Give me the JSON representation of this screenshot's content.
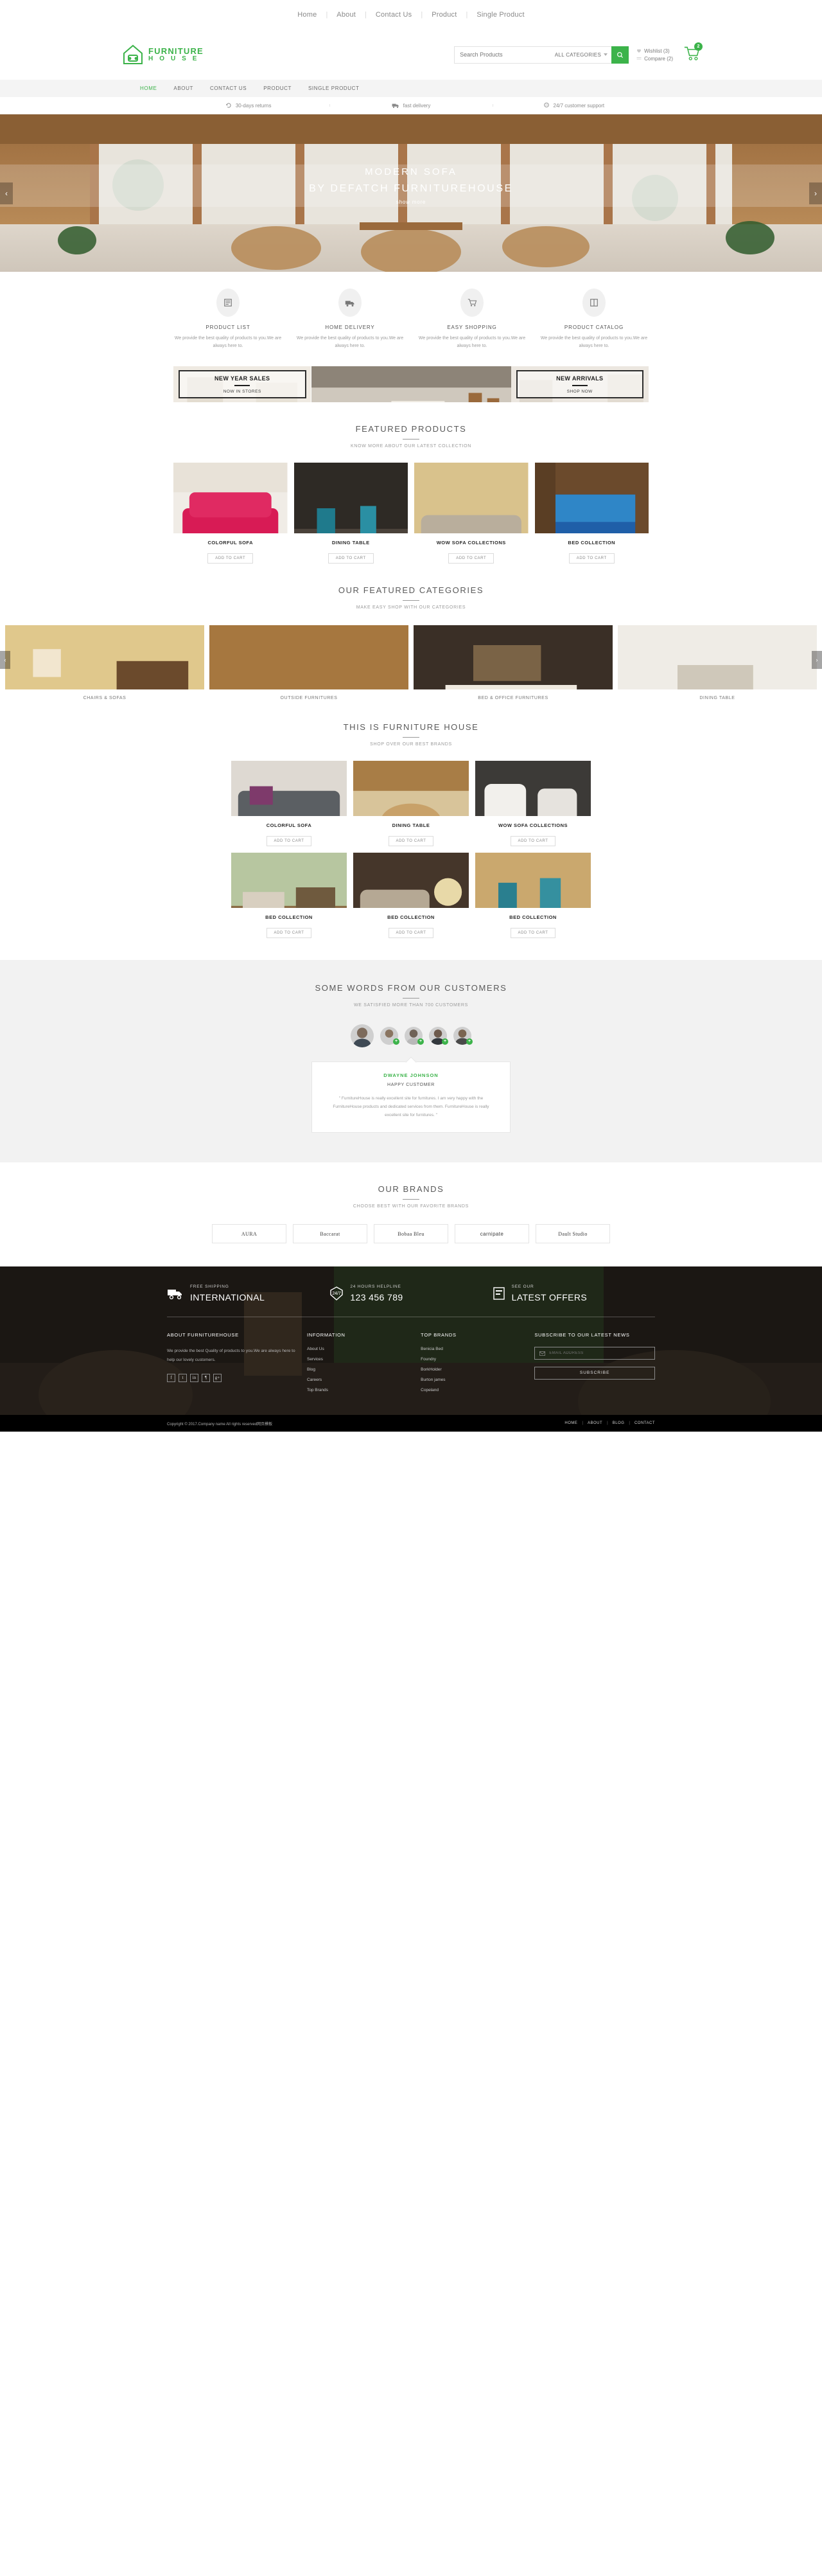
{
  "topbar": {
    "links": [
      "Home",
      "About",
      "Contact Us",
      "Product",
      "Single Product"
    ]
  },
  "header": {
    "logo_line1": "FURNITURE",
    "logo_line2": "H O U S E",
    "search_placeholder": "Search Products",
    "search_value": "",
    "category_select": "ALL CATEGORIES",
    "search_icon": "search-icon",
    "wishlist": "Wishlist (3)",
    "compare": "Compare (2)",
    "cart_count": "2",
    "accent_color": "#3cb34a"
  },
  "mainnav": {
    "items": [
      "HOME",
      "ABOUT",
      "CONTACT US",
      "PRODUCT",
      "SINGLE PRODUCT"
    ],
    "active_index": 0
  },
  "feature_strip": [
    {
      "icon": "returns-icon",
      "label": "30-days returns"
    },
    {
      "icon": "truck-icon",
      "label": "fast delivery"
    },
    {
      "icon": "support-icon",
      "label": "24/7 customer support"
    }
  ],
  "hero": {
    "title": "MODERN SOFA",
    "subtitle": "BY DEFATCH FURNITUREHOUSE",
    "cta": "show more",
    "prev_icon": "chevron-left-icon",
    "next_icon": "chevron-right-icon"
  },
  "services": [
    {
      "icon": "product-list-icon",
      "title": "PRODUCT LIST",
      "desc": "We provide the best quality of products to you.We are always here to."
    },
    {
      "icon": "delivery-truck-icon",
      "title": "HOME DELIVERY",
      "desc": "We provide the best quality of products to you.We are always here to."
    },
    {
      "icon": "shopping-cart-icon",
      "title": "EASY SHOPPING",
      "desc": "We provide the best quality of products to you.We are always here to."
    },
    {
      "icon": "catalog-book-icon",
      "title": "PRODUCT CATALOG",
      "desc": "We provide the best quality of products to you.We are always here to."
    }
  ],
  "promos": {
    "left": {
      "title": "NEW YEAR SALES",
      "sub": "NOW IN STORES"
    },
    "right": {
      "title": "NEW ARRIVALS",
      "sub": "SHOP NOW"
    }
  },
  "featured_products": {
    "title": "FEATURED PRODUCTS",
    "subtitle": "KNOW MORE ABOUT OUR LATEST COLLECTION",
    "add_to_cart_label": "ADD TO CART",
    "items": [
      {
        "name": "COLORFUL SOFA"
      },
      {
        "name": "DINING TABLE"
      },
      {
        "name": "WOW SOFA COLLECTIONS"
      },
      {
        "name": "BED COLLECTION"
      }
    ]
  },
  "categories": {
    "title": "OUR FEATURED CATEGORIES",
    "subtitle": "MAKE EASY SHOP WITH OUR CATEGORIES",
    "items": [
      {
        "name": "CHAIRS & SOFAS"
      },
      {
        "name": "OUTSIDE FURNITURES"
      },
      {
        "name": "BED & OFFICE FURNITURES"
      },
      {
        "name": "DINING TABLE"
      }
    ]
  },
  "this_is_fh": {
    "title": "THIS IS FURNITURE HOUSE",
    "subtitle": "SHOP OVER OUR BEST BRANDS",
    "add_to_cart_label": "ADD TO CART",
    "items": [
      {
        "name": "COLORFUL SOFA"
      },
      {
        "name": "DINING TABLE"
      },
      {
        "name": "WOW SOFA COLLECTIONS"
      },
      {
        "name": "BED COLLECTION"
      },
      {
        "name": "BED COLLECTION"
      },
      {
        "name": "BED COLLECTION"
      }
    ]
  },
  "testimonials": {
    "title": "SOME WORDS FROM OUR CUSTOMERS",
    "subtitle": "WE SATISFIED MORE THAN 700 CUSTOMERS",
    "active_name": "DWAYNE JOHNSON",
    "active_role": "HAPPY CUSTOMER",
    "active_quote": "\" FurnitureHouse is really excellent site for furnitures. I am very happy with the FurnitureHouse products and dedicated services from them. FurnitureHouse is really excellent site for furnitures. \"",
    "avatar_count": 5
  },
  "brands": {
    "title": "OUR BRANDS",
    "subtitle": "CHOOSE BEST WITH OUR FAVORITE BRANDS",
    "items": [
      "AURA",
      "Baccarat",
      "Bobaa Bleu",
      "carnipate",
      "Dault Studio"
    ]
  },
  "footer": {
    "highlights": [
      {
        "icon": "shipping-truck-icon",
        "small": "FREE SHIPPING",
        "big": "INTERNATIONAL"
      },
      {
        "icon": "clock-24-7-icon",
        "small": "24 HOURS HELPLINE",
        "big": "123 456 789"
      },
      {
        "icon": "offers-icon",
        "small": "SEE OUR",
        "big": "LATEST OFFERS"
      }
    ],
    "about": {
      "title": "ABOUT FURNITUREHOUSE",
      "text": "We provide the best Quality of products to you.We are always here to help our lovely customers.",
      "socials": [
        "f",
        "t",
        "in",
        "¶",
        "g+"
      ]
    },
    "information": {
      "title": "INFORMATION",
      "links": [
        "About Us",
        "Services",
        "Blog",
        "Careers",
        "Top Brands"
      ]
    },
    "top_brands": {
      "title": "TOP BRANDS",
      "links": [
        "Benicia Bed",
        "Foundry",
        "BorkHolder",
        "Burton james",
        "Copeland"
      ]
    },
    "subscribe": {
      "title": "SUBSCRIBE TO OUR LATEST NEWS",
      "placeholder": "EMAIL ADDRESS",
      "value": "",
      "button": "SUBSCRIBE",
      "mail_icon": "envelope-icon"
    },
    "copyright": "Copyright © 2017.Company name All rights reserved网页模板",
    "bottom_links": [
      "HOME",
      "ABOUT",
      "BLOG",
      "CONTACT"
    ]
  }
}
